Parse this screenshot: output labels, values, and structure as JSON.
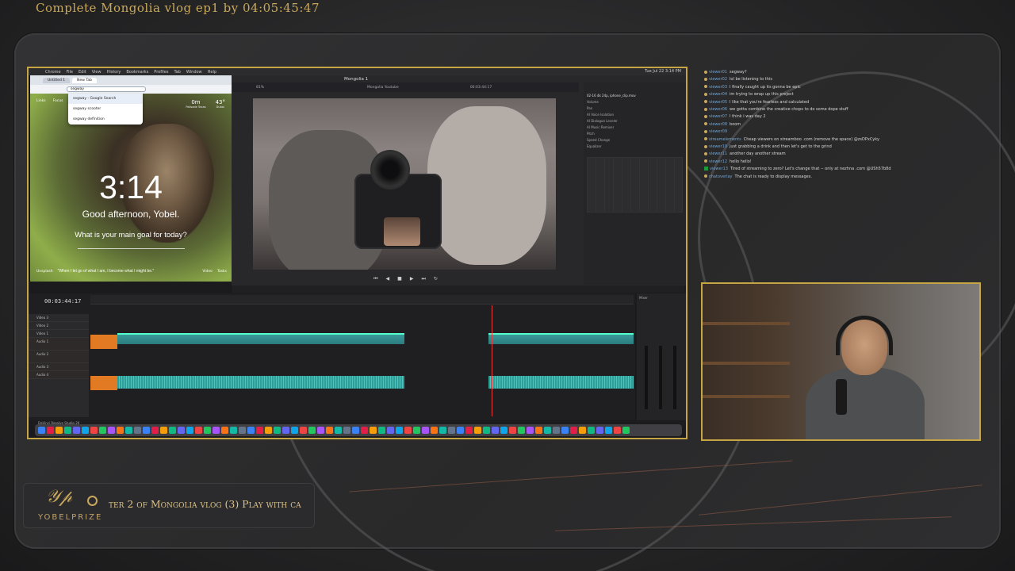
{
  "stream": {
    "title": "Complete Mongolia vlog ep1 by 04:05:45:47",
    "ticker": "ter 2 of Mongolia vlog (3) Play with ca",
    "brand": "YOBELPRIZE",
    "accent_color": "#c6a545"
  },
  "mac": {
    "apple_icon": "apple-icon",
    "menus": [
      "Chrome",
      "File",
      "Edit",
      "View",
      "History",
      "Bookmarks",
      "Profiles",
      "Tab",
      "Window",
      "Help"
    ],
    "clock": "Tue Jul 22 3:14 PM"
  },
  "browser": {
    "tabs": [
      "Untitled 1",
      "New Tab"
    ],
    "omnibox_value": "segway",
    "suggestions": [
      "segway - Google Search",
      "segway scooter",
      "segway definition"
    ],
    "quick_links": [
      "Links",
      "Focus"
    ],
    "weather": [
      {
        "value": "0m",
        "label": "Palisade Texas"
      },
      {
        "value": "43°",
        "label": "Dubai"
      }
    ],
    "clock": "3:14",
    "greeting": "Good afternoon, Yobel.",
    "goal_prompt": "What is your main goal for today?",
    "quote": "\"When I let go of what I am, I become what I might be.\"",
    "bottom_links": [
      "Unsplash",
      "Video",
      "Tasks"
    ]
  },
  "resolve": {
    "project_name": "Mongolia 1",
    "timeline_name": "Mongolia Youtube",
    "viewer_timecode": "00:03:44:17",
    "zoom": "81%",
    "tabs": [
      "Quick Export",
      "Mixer",
      "Metadata",
      "Inspector"
    ],
    "inspector_clip": "02-16 4k 24p, iphone_clip.mov",
    "inspector_rows": [
      "Volume",
      "Pan",
      "AI Voice Isolation",
      "AI Dialogue Leveler",
      "AI Music Remixer",
      "Pitch",
      "Speed Change",
      "Equalizer"
    ],
    "timeline_timecode": "00:03:44:17",
    "track_heads": [
      "Video 3",
      "Video 2",
      "Video 1",
      "Audio 1",
      "Audio 2",
      "Audio 3",
      "Audio 4"
    ],
    "mixer_label": "Mixer",
    "app_label": "DaVinci Resolve Studio 20"
  },
  "chat": [
    {
      "user": "viewer01",
      "msg": "segway?"
    },
    {
      "user": "viewer02",
      "msg": "lol be listening to this"
    },
    {
      "user": "viewer03",
      "msg": "I finally caught up its gonna be epic"
    },
    {
      "user": "viewer04",
      "msg": "im trying to wrap up this project"
    },
    {
      "user": "viewer05",
      "msg": "I like that you're fearless and calculated"
    },
    {
      "user": "viewer06",
      "msg": "we gotta combine the creative chops to do some dope stuff"
    },
    {
      "user": "viewer07",
      "msg": "I think i was day 2"
    },
    {
      "user": "viewer08",
      "msg": "boom"
    },
    {
      "user": "viewer09",
      "msg": ""
    },
    {
      "user": "streamelements",
      "msg": "Cheap viewers on streamboo .com (remove the space) @zsDPxCyky"
    },
    {
      "user": "viewer10",
      "msg": "just grabbing a drink and then let's get to the grind"
    },
    {
      "user": "viewer11",
      "msg": "another day another stream"
    },
    {
      "user": "viewer12",
      "msg": "hello hello!"
    },
    {
      "user": "viewer13",
      "msg": "Tired of streaming to zero? Let's change that -- only at nezhna .com @USh57b8d"
    },
    {
      "user": "chatoverlay",
      "msg": "The chat is ready to display messages."
    }
  ]
}
